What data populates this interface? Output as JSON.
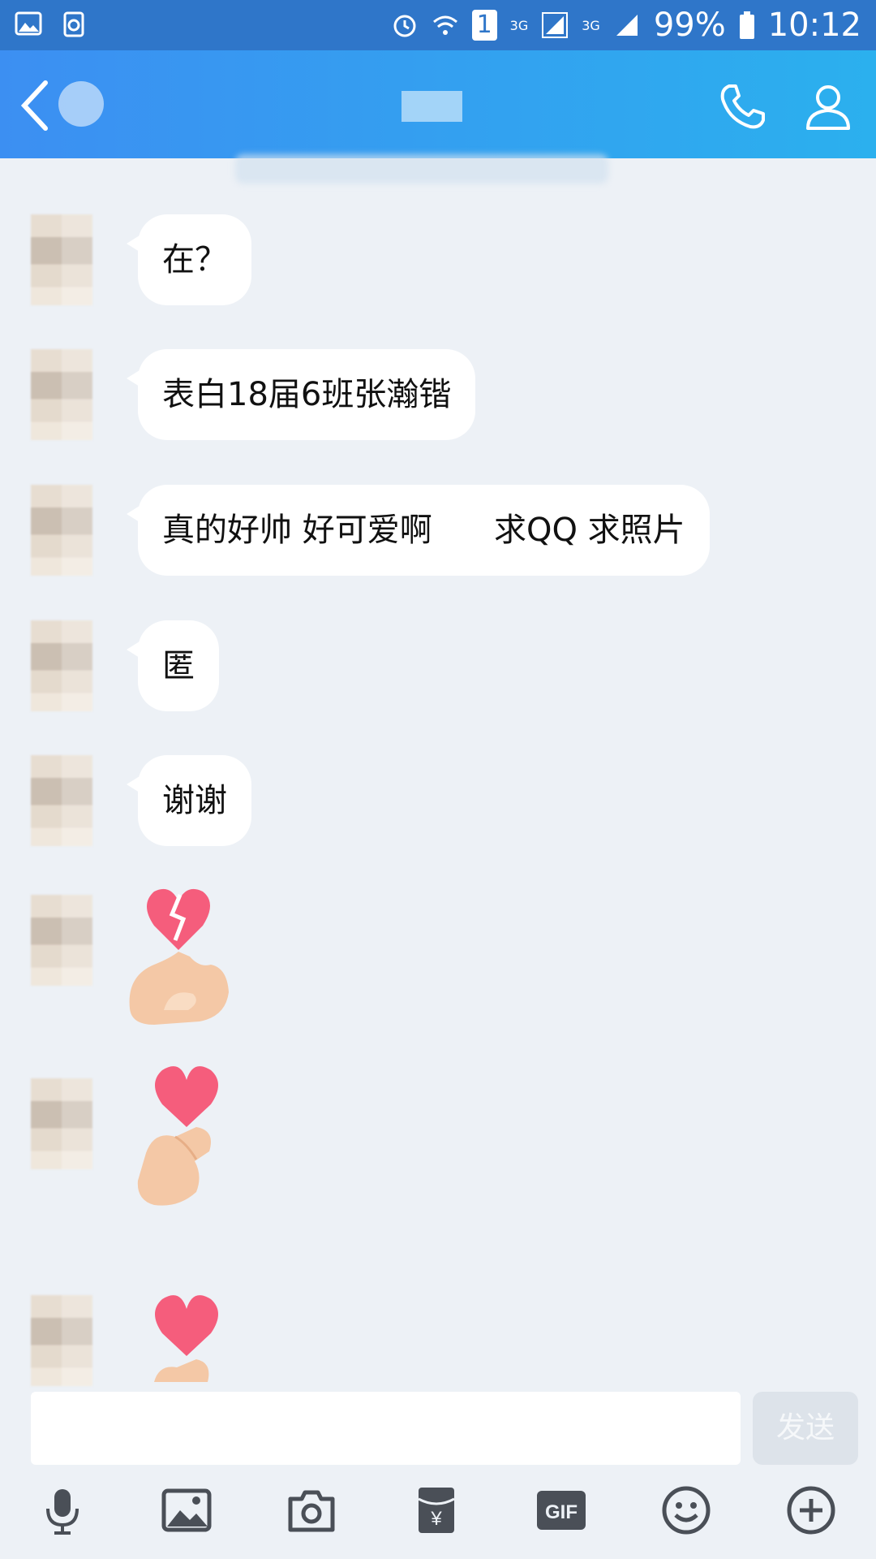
{
  "status_bar": {
    "network_1": "3G",
    "network_2": "3G",
    "sim": "1",
    "battery": "99%",
    "time": "10:12"
  },
  "messages": [
    {
      "type": "text",
      "text": "在？"
    },
    {
      "type": "text",
      "text": "表白18届6班张瀚锴"
    },
    {
      "type": "text",
      "text": "真的好帅 好可爱啊      求QQ 求照片"
    },
    {
      "type": "text",
      "text": "匿"
    },
    {
      "type": "text",
      "text": "谢谢"
    },
    {
      "type": "sticker",
      "icon": "broken-heart-hand-sticker"
    },
    {
      "type": "sticker",
      "icon": "finger-heart-sticker"
    },
    {
      "type": "sticker",
      "icon": "finger-heart-sticker"
    }
  ],
  "input": {
    "value": "",
    "send_label": "发送"
  },
  "toolbar": [
    "microphone-icon",
    "image-icon",
    "camera-icon",
    "red-packet-icon",
    "gif-icon",
    "emoji-icon",
    "plus-icon"
  ],
  "colors": {
    "header_start": "#3c8ff2",
    "header_end": "#2bb0ee",
    "status_bar": "#2f76c9",
    "background": "#edf1f6",
    "bubble": "#ffffff",
    "toolbar_icon": "#4a4f57"
  }
}
